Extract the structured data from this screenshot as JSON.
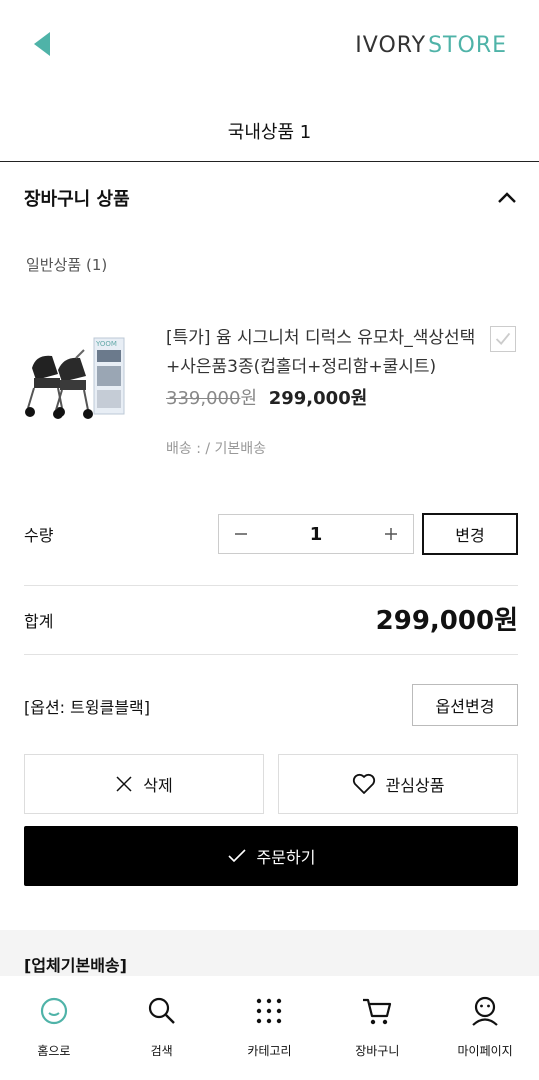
{
  "header": {
    "logo_ivory": "IVORY",
    "logo_store": "STORE"
  },
  "page_title": "국내상품 1",
  "section": {
    "title": "장바구니 상품",
    "subhead": "일반상품 (1)"
  },
  "product": {
    "name": "[특가] 윰 시그니처 디럭스 유모차_색상선택+사은품3종(컵홀더+정리함+쿨시트)",
    "old_price": "339,000",
    "old_won": "원",
    "new_price": "299,000원",
    "shipping": "배송 : / 기본배송"
  },
  "quantity": {
    "label": "수량",
    "value": "1",
    "change_label": "변경"
  },
  "total": {
    "label": "합계",
    "value": "299,000원"
  },
  "option": {
    "label": "[옵션: 트윙클블랙]",
    "change_label": "옵션변경"
  },
  "actions": {
    "delete_label": "삭제",
    "wish_label": "관심상품",
    "order_label": "주문하기"
  },
  "shipping_group": "[업체기본배송]",
  "tabbar": {
    "items": [
      {
        "label": "홈으로",
        "icon": "home-smile-icon"
      },
      {
        "label": "검색",
        "icon": "search-icon"
      },
      {
        "label": "카테고리",
        "icon": "grid-dots-icon"
      },
      {
        "label": "장바구니",
        "icon": "cart-icon"
      },
      {
        "label": "마이페이지",
        "icon": "user-icon"
      }
    ]
  },
  "colors": {
    "accent": "#4fb3a8",
    "primary_button": "#000000"
  }
}
